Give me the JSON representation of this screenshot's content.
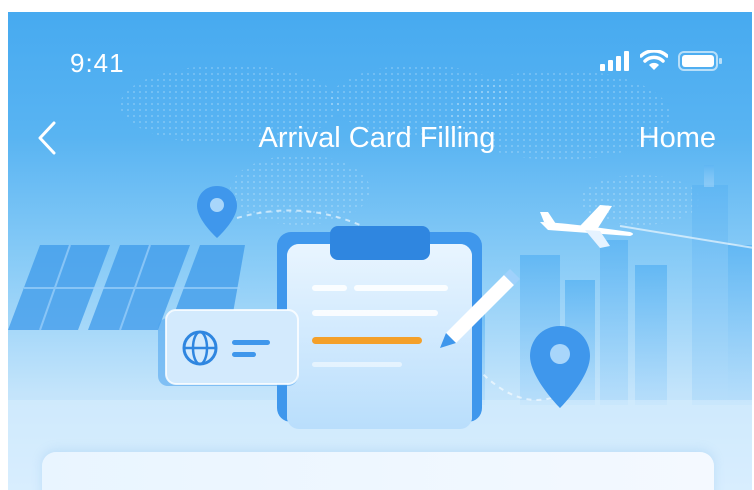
{
  "status_bar": {
    "time": "9:41",
    "icons": [
      "signal-icon",
      "wifi-icon",
      "battery-icon"
    ]
  },
  "nav": {
    "back_icon": "chevron-left-icon",
    "title": "Arrival Card Filling",
    "home_label": "Home"
  },
  "illustration": {
    "icons": [
      "location-pin-icon",
      "airplane-icon",
      "globe-icon",
      "pencil-icon",
      "clipboard-icon"
    ]
  },
  "colors": {
    "sky_top": "#45a9f0",
    "sky_bottom": "#dcefff",
    "accent_orange": "#f4a02a",
    "pin_blue": "#3f97ec"
  }
}
